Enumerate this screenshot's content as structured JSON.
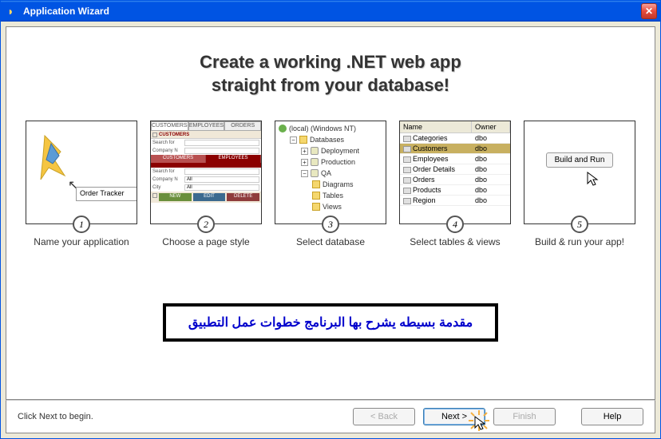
{
  "window": {
    "title": "Application Wizard"
  },
  "headline": {
    "line1": "Create a working .NET web app",
    "line2": "straight from your database!"
  },
  "steps": {
    "s1": {
      "num": "1",
      "label": "Name your application",
      "input_value": "Order Tracker"
    },
    "s2": {
      "num": "2",
      "label": "Choose a page style",
      "tabs": [
        "CUSTOMERS",
        "EMPLOYEES",
        "ORDERS"
      ],
      "header": "CUSTOMERS",
      "search_label": "Search for",
      "company_label": "Company N",
      "city_label": "City",
      "red_tabs": [
        "CUSTOMERS",
        "EMPLOYEES"
      ],
      "all_value": "All",
      "btns": [
        "NEW",
        "EDIT",
        "DELETE"
      ]
    },
    "s3": {
      "num": "3",
      "label": "Select database",
      "root": "(local) (Windows NT)",
      "db_label": "Databases",
      "nodes": [
        "Deployment",
        "Production",
        "QA"
      ],
      "qa_children": [
        "Diagrams",
        "Tables",
        "Views"
      ]
    },
    "s4": {
      "num": "4",
      "label": "Select tables & views",
      "cols": [
        "Name",
        "Owner"
      ],
      "rows": [
        {
          "name": "Categories",
          "owner": "dbo",
          "sel": false
        },
        {
          "name": "Customers",
          "owner": "dbo",
          "sel": true
        },
        {
          "name": "Employees",
          "owner": "dbo",
          "sel": false
        },
        {
          "name": "Order Details",
          "owner": "dbo",
          "sel": false
        },
        {
          "name": "Orders",
          "owner": "dbo",
          "sel": false
        },
        {
          "name": "Products",
          "owner": "dbo",
          "sel": false
        },
        {
          "name": "Region",
          "owner": "dbo",
          "sel": false
        }
      ]
    },
    "s5": {
      "num": "5",
      "label": "Build & run your app!",
      "button": "Build and Run"
    }
  },
  "arabic": "مقدمة بسيطه يشرح بها البرنامج خطوات عمل التطبيق",
  "footer": {
    "hint": "Click Next to begin.",
    "back": "< Back",
    "next": "Next >",
    "finish": "Finish",
    "help": "Help"
  }
}
